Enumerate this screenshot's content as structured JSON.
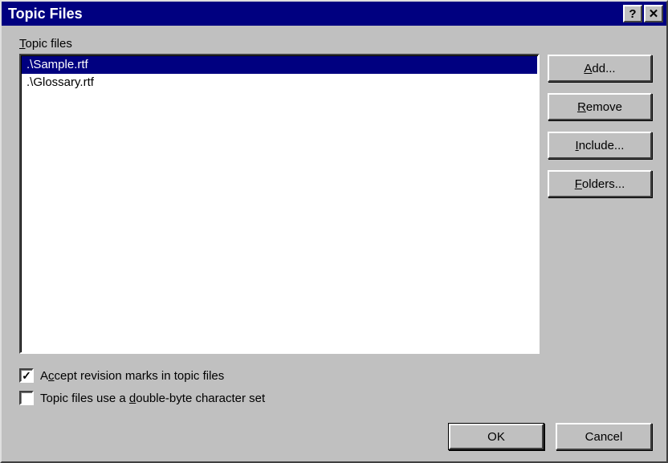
{
  "window": {
    "title": "Topic Files"
  },
  "list": {
    "label_pre": "T",
    "label_post": "opic files",
    "items": [
      {
        "text": ".\\Sample.rtf",
        "selected": true
      },
      {
        "text": ".\\Glossary.rtf",
        "selected": false
      }
    ]
  },
  "buttons": {
    "add_pre": "A",
    "add_post": "dd...",
    "remove_pre": "R",
    "remove_post": "emove",
    "include_pre": "I",
    "include_post": "nclude...",
    "folders_pre": "F",
    "folders_post": "olders...",
    "ok": "OK",
    "cancel": "Cancel"
  },
  "checks": {
    "accept": {
      "checked": true,
      "pre": "A",
      "mid": "c",
      "post": "cept revision marks in topic files"
    },
    "doublebyte": {
      "checked": false,
      "pre": "Topic files use a ",
      "mid": "d",
      "post": "ouble-byte character set"
    }
  }
}
